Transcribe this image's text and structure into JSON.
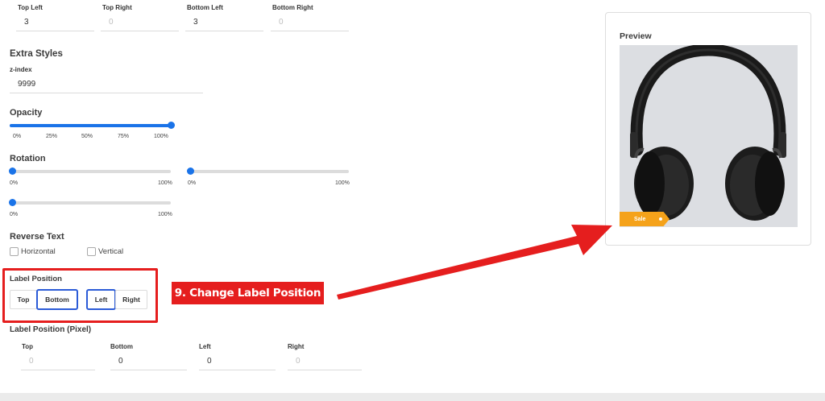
{
  "border_radius": {
    "labels": [
      "Top Left",
      "Top Right",
      "Bottom Left",
      "Bottom Right"
    ],
    "values": [
      "3",
      "0",
      "3",
      "0"
    ]
  },
  "extra_styles": {
    "title": "Extra Styles",
    "zindex_label": "z-index",
    "zindex_value": "9999"
  },
  "opacity": {
    "title": "Opacity",
    "level": 1.0,
    "ticks": [
      "0%",
      "25%",
      "50%",
      "75%",
      "100%"
    ]
  },
  "rotation": {
    "title": "Rotation",
    "sliders": [
      {
        "min": "0%",
        "max": "100%",
        "level": 0
      },
      {
        "min": "0%",
        "max": "100%",
        "level": 0
      },
      {
        "min": "0%",
        "max": "100%",
        "level": 0
      }
    ]
  },
  "reverse_text": {
    "title": "Reverse Text",
    "horizontal": "Horizontal",
    "vertical": "Vertical"
  },
  "label_position": {
    "title": "Label Position",
    "buttons": [
      "Top",
      "Bottom",
      "Left",
      "Right"
    ],
    "active": [
      "Bottom",
      "Left"
    ]
  },
  "label_position_pixel": {
    "title": "Label Position (Pixel)",
    "labels": [
      "Top",
      "Bottom",
      "Left",
      "Right"
    ],
    "values": [
      "0",
      "0",
      "0",
      "0"
    ]
  },
  "annotation": {
    "callout_text": "9. Change Label Position",
    "color": "#e51e1e"
  },
  "preview": {
    "title": "Preview",
    "badge_text": "Sale",
    "badge_color": "#f5a21a",
    "image_icon": "headphones-icon"
  },
  "colors": {
    "accent": "#1a73e8",
    "active_border": "#2b5bd7"
  }
}
